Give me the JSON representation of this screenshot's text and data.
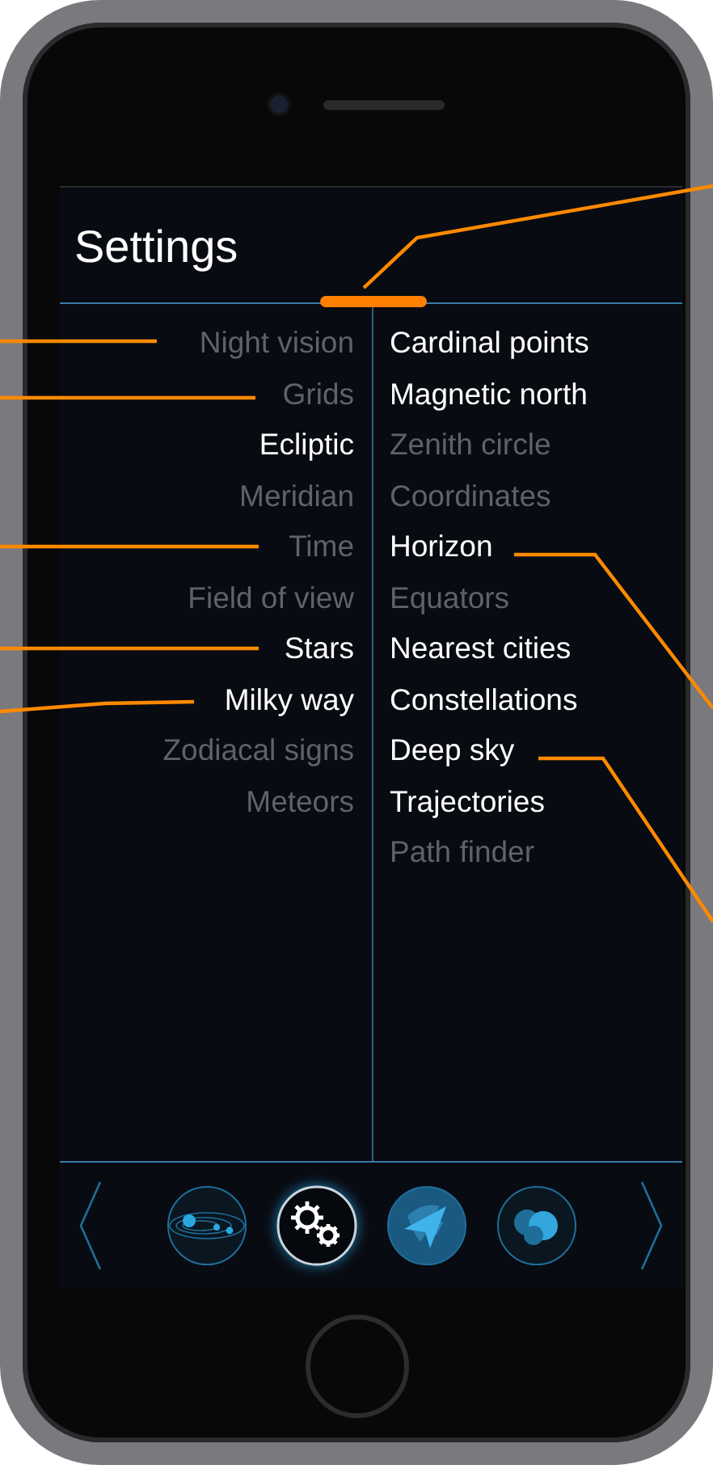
{
  "screen": {
    "title": "Settings"
  },
  "left_items": [
    {
      "label": "Night vision",
      "on": false
    },
    {
      "label": "Grids",
      "on": false
    },
    {
      "label": "Ecliptic",
      "on": true
    },
    {
      "label": "Meridian",
      "on": false
    },
    {
      "label": "Time",
      "on": false
    },
    {
      "label": "Field of view",
      "on": false
    },
    {
      "label": "Stars",
      "on": true
    },
    {
      "label": "Milky way",
      "on": true
    },
    {
      "label": "Zodiacal signs",
      "on": false
    },
    {
      "label": "Meteors",
      "on": false
    }
  ],
  "right_items": [
    {
      "label": "Cardinal points",
      "on": true
    },
    {
      "label": "Magnetic north",
      "on": true
    },
    {
      "label": "Zenith circle",
      "on": false
    },
    {
      "label": "Coordinates",
      "on": false
    },
    {
      "label": "Horizon",
      "on": true
    },
    {
      "label": "Equators",
      "on": false
    },
    {
      "label": "Nearest cities",
      "on": true
    },
    {
      "label": "Constellations",
      "on": true
    },
    {
      "label": "Deep sky",
      "on": true
    },
    {
      "label": "Trajectories",
      "on": true
    },
    {
      "label": "Path finder",
      "on": false
    }
  ],
  "nav": {
    "items": [
      {
        "kind": "orbits",
        "selected": false
      },
      {
        "kind": "gears",
        "selected": true
      },
      {
        "kind": "globe",
        "selected": false
      },
      {
        "kind": "letters",
        "selected": false
      }
    ]
  }
}
